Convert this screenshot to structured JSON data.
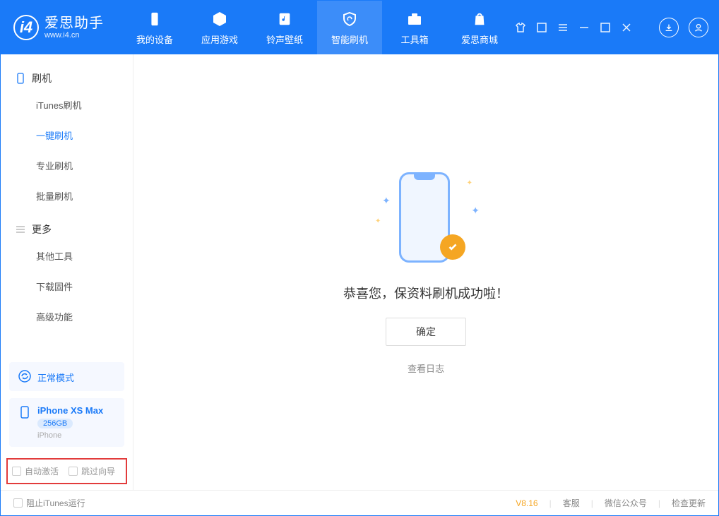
{
  "app": {
    "name": "爱思助手",
    "url": "www.i4.cn"
  },
  "tabs": [
    {
      "label": "我的设备"
    },
    {
      "label": "应用游戏"
    },
    {
      "label": "铃声壁纸"
    },
    {
      "label": "智能刷机"
    },
    {
      "label": "工具箱"
    },
    {
      "label": "爱思商城"
    }
  ],
  "sidebar": {
    "group1": {
      "title": "刷机",
      "items": [
        "iTunes刷机",
        "一键刷机",
        "专业刷机",
        "批量刷机"
      ]
    },
    "group2": {
      "title": "更多",
      "items": [
        "其他工具",
        "下载固件",
        "高级功能"
      ]
    },
    "mode": "正常模式",
    "device": {
      "name": "iPhone XS Max",
      "storage": "256GB",
      "type": "iPhone"
    },
    "opts": {
      "auto_activate": "自动激活",
      "skip_guide": "跳过向导"
    }
  },
  "main": {
    "success_text": "恭喜您，保资料刷机成功啦！",
    "ok_label": "确定",
    "log_link": "查看日志"
  },
  "footer": {
    "block_itunes": "阻止iTunes运行",
    "version": "V8.16",
    "links": {
      "support": "客服",
      "wechat": "微信公众号",
      "update": "检查更新"
    }
  }
}
